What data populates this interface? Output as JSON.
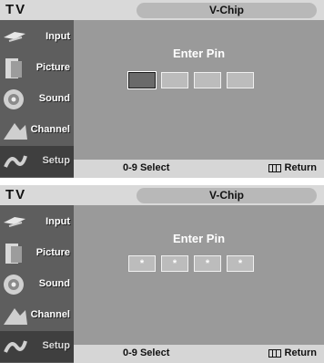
{
  "screens": [
    {
      "tv_label": "TV",
      "title": "V-Chip",
      "menu": [
        {
          "label": "Input",
          "icon": "input-icon"
        },
        {
          "label": "Picture",
          "icon": "picture-icon"
        },
        {
          "label": "Sound",
          "icon": "sound-icon"
        },
        {
          "label": "Channel",
          "icon": "channel-icon"
        },
        {
          "label": "Setup",
          "icon": "setup-icon",
          "active": true
        }
      ],
      "prompt": "Enter Pin",
      "pin_digits": [
        "",
        "",
        "",
        ""
      ],
      "footer_left": "0-9 Select",
      "footer_right": "Return"
    },
    {
      "tv_label": "TV",
      "title": "V-Chip",
      "menu": [
        {
          "label": "Input",
          "icon": "input-icon"
        },
        {
          "label": "Picture",
          "icon": "picture-icon"
        },
        {
          "label": "Sound",
          "icon": "sound-icon"
        },
        {
          "label": "Channel",
          "icon": "channel-icon"
        },
        {
          "label": "Setup",
          "icon": "setup-icon",
          "active": true
        }
      ],
      "prompt": "Enter Pin",
      "pin_digits": [
        "*",
        "*",
        "*",
        "*"
      ],
      "footer_left": "0-9 Select",
      "footer_right": "Return"
    }
  ]
}
